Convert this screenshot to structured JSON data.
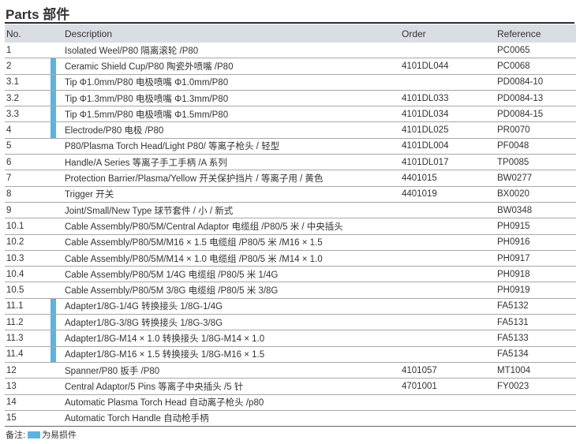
{
  "title": "Parts 部件",
  "headers": {
    "no": "No.",
    "description": "Description",
    "order": "Order",
    "reference": "Reference"
  },
  "rows": [
    {
      "no": "1",
      "desc": "Isolated Weel/P80 隔离滚轮 /P80",
      "order": "",
      "ref": "PC0065",
      "wear": false
    },
    {
      "no": "2",
      "desc": "Ceramic Shield Cup/P80 陶瓷外喷嘴 /P80",
      "order": "4101DL044",
      "ref": "PC0068",
      "wear": true
    },
    {
      "no": "3.1",
      "desc": "Tip Φ1.0mm/P80 电极喷嘴 Φ1.0mm/P80",
      "order": "",
      "ref": "PD0084-10",
      "wear": true
    },
    {
      "no": "3.2",
      "desc": "Tip Φ1.3mm/P80 电极喷嘴 Φ1.3mm/P80",
      "order": "4101DL033",
      "ref": "PD0084-13",
      "wear": true
    },
    {
      "no": "3.3",
      "desc": "Tip Φ1.5mm/P80 电极喷嘴 Φ1.5mm/P80",
      "order": "4101DL034",
      "ref": "PD0084-15",
      "wear": true
    },
    {
      "no": "4",
      "desc": "Electrode/P80 电极 /P80",
      "order": "4101DL025",
      "ref": "PR0070",
      "wear": true
    },
    {
      "no": "5",
      "desc": "P80/Plasma Torch Head/Light P80/ 等离子枪头 / 轻型",
      "order": "4101DL004",
      "ref": "PF0048",
      "wear": false
    },
    {
      "no": "6",
      "desc": "Handle/A Series 等离子手工手柄 /A 系列",
      "order": "4101DL017",
      "ref": "TP0085",
      "wear": false
    },
    {
      "no": "7",
      "desc": "Protection Barrier/Plasma/Yellow 开关保护挡片 / 等离子用 / 黄色",
      "order": "4401015",
      "ref": "BW0277",
      "wear": false
    },
    {
      "no": "8",
      "desc": "Trigger 开关",
      "order": "4401019",
      "ref": "BX0020",
      "wear": false
    },
    {
      "no": "9",
      "desc": "Joint/Small/New Type 球节套件 / 小 / 新式",
      "order": "",
      "ref": "BW0348",
      "wear": false
    },
    {
      "no": "10.1",
      "desc": "Cable Assembly/P80/5M/Central Adaptor 电缆组 /P80/5 米 / 中央插头",
      "order": "",
      "ref": "PH0915",
      "wear": false
    },
    {
      "no": "10.2",
      "desc": "Cable Assembly/P80/5M/M16 × 1.5 电缆组 /P80/5 米 /M16 × 1.5",
      "order": "",
      "ref": "PH0916",
      "wear": false
    },
    {
      "no": "10.3",
      "desc": "Cable Assembly/P80/5M/M14 × 1.0 电缆组 /P80/5 米 /M14 × 1.0",
      "order": "",
      "ref": "PH0917",
      "wear": false
    },
    {
      "no": "10.4",
      "desc": "Cable Assembly/P80/5M 1/4G 电缆组 /P80/5 米 1/4G",
      "order": "",
      "ref": "PH0918",
      "wear": false
    },
    {
      "no": "10.5",
      "desc": "Cable Assembly/P80/5M 3/8G 电缆组 /P80/5 米 3/8G",
      "order": "",
      "ref": "PH0919",
      "wear": false
    },
    {
      "no": "11.1",
      "desc": "Adapter1/8G-1/4G 转换接头 1/8G-1/4G",
      "order": "",
      "ref": "FA5132",
      "wear": true
    },
    {
      "no": "11.2",
      "desc": "Adapter1/8G-3/8G 转换接头 1/8G-3/8G",
      "order": "",
      "ref": "FA5131",
      "wear": true
    },
    {
      "no": "11.3",
      "desc": "Adapter1/8G-M14 × 1.0 转换接头 1/8G-M14 × 1.0",
      "order": "",
      "ref": "FA5133",
      "wear": true
    },
    {
      "no": "11.4",
      "desc": "Adapter1/8G-M16 × 1.5 转换接头 1/8G-M16 × 1.5",
      "order": "",
      "ref": "FA5134",
      "wear": true
    },
    {
      "no": "12",
      "desc": "Spanner/P80 扳手 /P80",
      "order": "4101057",
      "ref": "MT1004",
      "wear": false
    },
    {
      "no": "13",
      "desc": "Central Adaptor/5 Pins 等离子中央插头 /5 针",
      "order": "4701001",
      "ref": "FY0023",
      "wear": false
    },
    {
      "no": "14",
      "desc": "Automatic Plasma Torch Head 自动离子枪头 /p80",
      "order": "",
      "ref": "",
      "wear": false
    },
    {
      "no": "15",
      "desc": "Automatic Torch Handle 自动枪手柄",
      "order": "",
      "ref": "",
      "wear": false
    }
  ],
  "note": {
    "prefix": "备注:",
    "legend": "为易损件"
  },
  "colors": {
    "wear_marker": "#5ab4e2",
    "header_bg": "#d9dde4"
  }
}
